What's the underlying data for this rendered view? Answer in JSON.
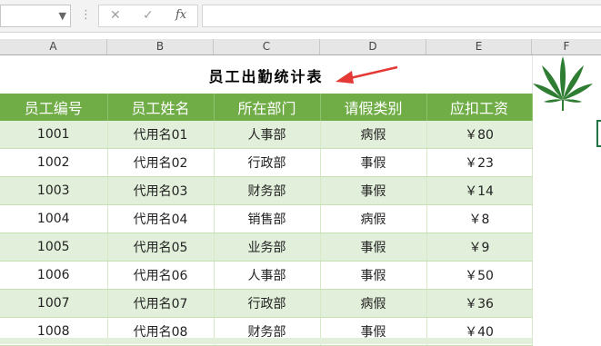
{
  "formula_bar": {
    "cancel_icon": "✕",
    "enter_icon": "✓",
    "fx_label": "fx",
    "separator": "⋮"
  },
  "columns": [
    "A",
    "B",
    "C",
    "D",
    "E",
    "F"
  ],
  "sheet": {
    "title": "员工出勤统计表",
    "headers": [
      "员工编号",
      "员工姓名",
      "所在部门",
      "请假类别",
      "应扣工资"
    ],
    "rows": [
      [
        "1001",
        "代用名01",
        "人事部",
        "病假",
        "￥80"
      ],
      [
        "1002",
        "代用名02",
        "行政部",
        "事假",
        "￥23"
      ],
      [
        "1003",
        "代用名03",
        "财务部",
        "事假",
        "￥14"
      ],
      [
        "1004",
        "代用名04",
        "销售部",
        "病假",
        "￥8"
      ],
      [
        "1005",
        "代用名05",
        "业务部",
        "事假",
        "￥9"
      ],
      [
        "1006",
        "代用名06",
        "人事部",
        "事假",
        "￥50"
      ],
      [
        "1007",
        "代用名07",
        "行政部",
        "病假",
        "￥36"
      ],
      [
        "1008",
        "代用名08",
        "财务部",
        "事假",
        "￥40"
      ]
    ]
  },
  "colors": {
    "header_green": "#70ad47",
    "band_green": "#e2efda",
    "arrow_red": "#e53935",
    "leaf_green": "#2e7d32"
  }
}
